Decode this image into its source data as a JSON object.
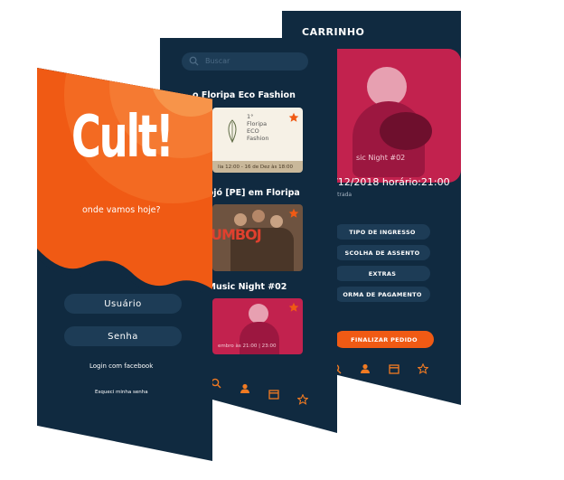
{
  "colors": {
    "navy": "#102a40",
    "field": "#1d3c56",
    "orange": "#f05a14",
    "orange_light": "#f7944a",
    "crimson": "#c2224e"
  },
  "cart": {
    "title": "CARRINHO",
    "image_caption": "sic Night #02",
    "date_text": "/12/2018  horário:21:00",
    "subtitle": "strada",
    "options": [
      "TIPO DE INGRESSO",
      "SCOLHA DE ASSENTO",
      "EXTRAS",
      "ORMA DE PAGAMENTO"
    ],
    "finish_button": "FINALIZAR PEDIDO",
    "tab_icons": [
      "search-icon",
      "user-icon",
      "calendar-icon",
      "star-icon"
    ]
  },
  "events": {
    "search_placeholder": "Buscar",
    "items": [
      {
        "title": "o Floripa Eco Fashion",
        "poster_lines": [
          "1°",
          "Floripa",
          "ECO",
          "Fashion"
        ],
        "info": "lia 12:00 - 16 de Dez às 18:00"
      },
      {
        "title": "mbojó [PE] em Floripa",
        "poster_text": "UMBOJ",
        "info": ""
      },
      {
        "title": "ue Music Night #02",
        "info": "embro às 21:00 | 23:00"
      }
    ],
    "tab_icons": [
      "search-icon",
      "user-icon",
      "calendar-icon",
      "star-icon"
    ]
  },
  "login": {
    "logo": "Cult!",
    "tagline": "onde vamos hoje?",
    "username_field": "Usuário",
    "password_field": "Senha",
    "facebook_link": "Login com facebook",
    "forgot_link": "Esqueci minha senha"
  }
}
